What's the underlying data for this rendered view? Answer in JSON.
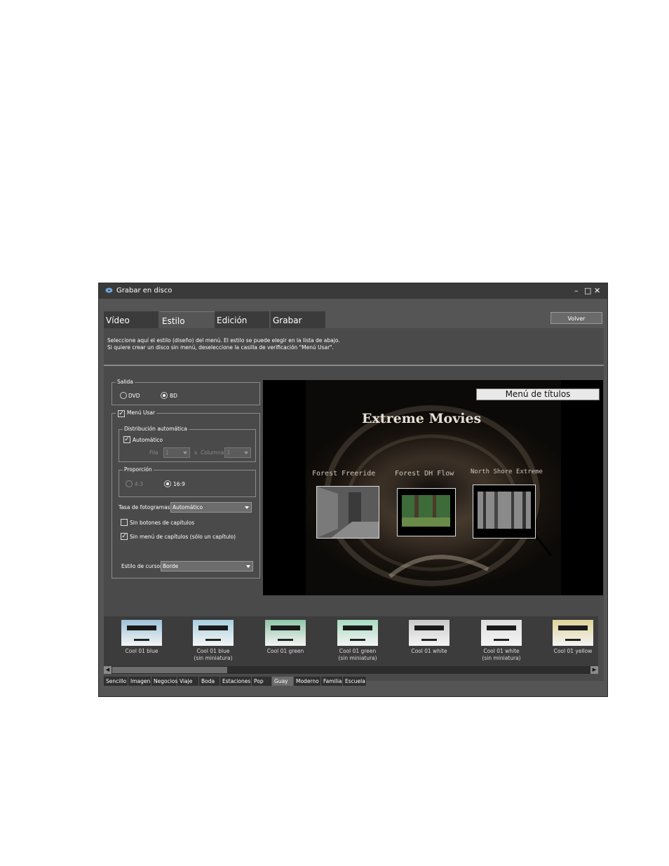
{
  "window": {
    "title": "Grabar en disco",
    "controls": {
      "minimize": "–",
      "maximize": "□",
      "close": "✕"
    }
  },
  "tabs": [
    {
      "label": "Vídeo",
      "active": false
    },
    {
      "label": "Estilo",
      "active": true
    },
    {
      "label": "Edición",
      "active": false
    },
    {
      "label": "Grabar",
      "active": false
    }
  ],
  "volver_label": "Volver",
  "instructions": {
    "line1": "Seleccione aquí el estilo (diseño) del menú. El estilo se puede elegir en la lista de abajo.",
    "line2": "Si quiere crear un disco sin menú, deseleccione la casilla de verificación \"Menú Usar\"."
  },
  "salida": {
    "title": "Salida",
    "options": [
      {
        "label": "DVD",
        "selected": false
      },
      {
        "label": "BD",
        "selected": true
      }
    ]
  },
  "menu_usar": {
    "label": "Menú Usar",
    "checked": true,
    "distribucion": {
      "title": "Distribución automática",
      "automatico_label": "Automático",
      "automatico_checked": true,
      "fila_label": "Fila",
      "fila_value": "1",
      "x_label": "x",
      "columna_label": "Columna",
      "columna_value": "3"
    },
    "proporcion": {
      "title": "Proporción",
      "options": [
        {
          "label": "4:3",
          "selected": false
        },
        {
          "label": "16:9",
          "selected": true
        }
      ]
    },
    "tasa_label": "Tasa de fotogramas",
    "tasa_value": "Automático",
    "sin_botones_label": "Sin botones de capítulos",
    "sin_botones_checked": false,
    "sin_menu_label": "Sin menú de capítulos (sólo un capítulo)",
    "sin_menu_checked": true,
    "cursor_label": "Estilo de cursor",
    "cursor_value": "Borde"
  },
  "preview": {
    "menu_title": "Menú de títulos",
    "movie_title": "Extreme Movies",
    "clips": [
      "Forest Freeride",
      "Forest DH Flow",
      "North Shore Extreme"
    ]
  },
  "styles": [
    {
      "name": "Cool 01 blue",
      "sub": "",
      "color": "#9cc3d8",
      "selected": false
    },
    {
      "name": "Cool 01 blue",
      "sub": "(sin miniatura)",
      "color": "#a9cfe0",
      "selected": false
    },
    {
      "name": "Cool 01 green",
      "sub": "",
      "color": "#8fc6a6",
      "selected": false
    },
    {
      "name": "Cool 01 green",
      "sub": "(sin miniatura)",
      "color": "#a8dbc0",
      "selected": false
    },
    {
      "name": "Cool 01 white",
      "sub": "",
      "color": "#c9c9c9",
      "selected": false
    },
    {
      "name": "Cool 01 white",
      "sub": "(sin miniatura)",
      "color": "#dedede",
      "selected": false
    },
    {
      "name": "Cool 01 yellow",
      "sub": "",
      "color": "#dfd49a",
      "selected": false
    }
  ],
  "categories": [
    {
      "label": "Sencillo",
      "active": false
    },
    {
      "label": "Imagen",
      "active": false
    },
    {
      "label": "Negocios",
      "active": false
    },
    {
      "label": "Viaje",
      "active": false
    },
    {
      "label": "Boda",
      "active": false
    },
    {
      "label": "Estaciones",
      "active": false
    },
    {
      "label": "Pop",
      "active": false
    },
    {
      "label": "Guay",
      "active": true
    },
    {
      "label": "Moderno",
      "active": false
    },
    {
      "label": "Familia",
      "active": false
    },
    {
      "label": "Escuela",
      "active": false
    }
  ]
}
